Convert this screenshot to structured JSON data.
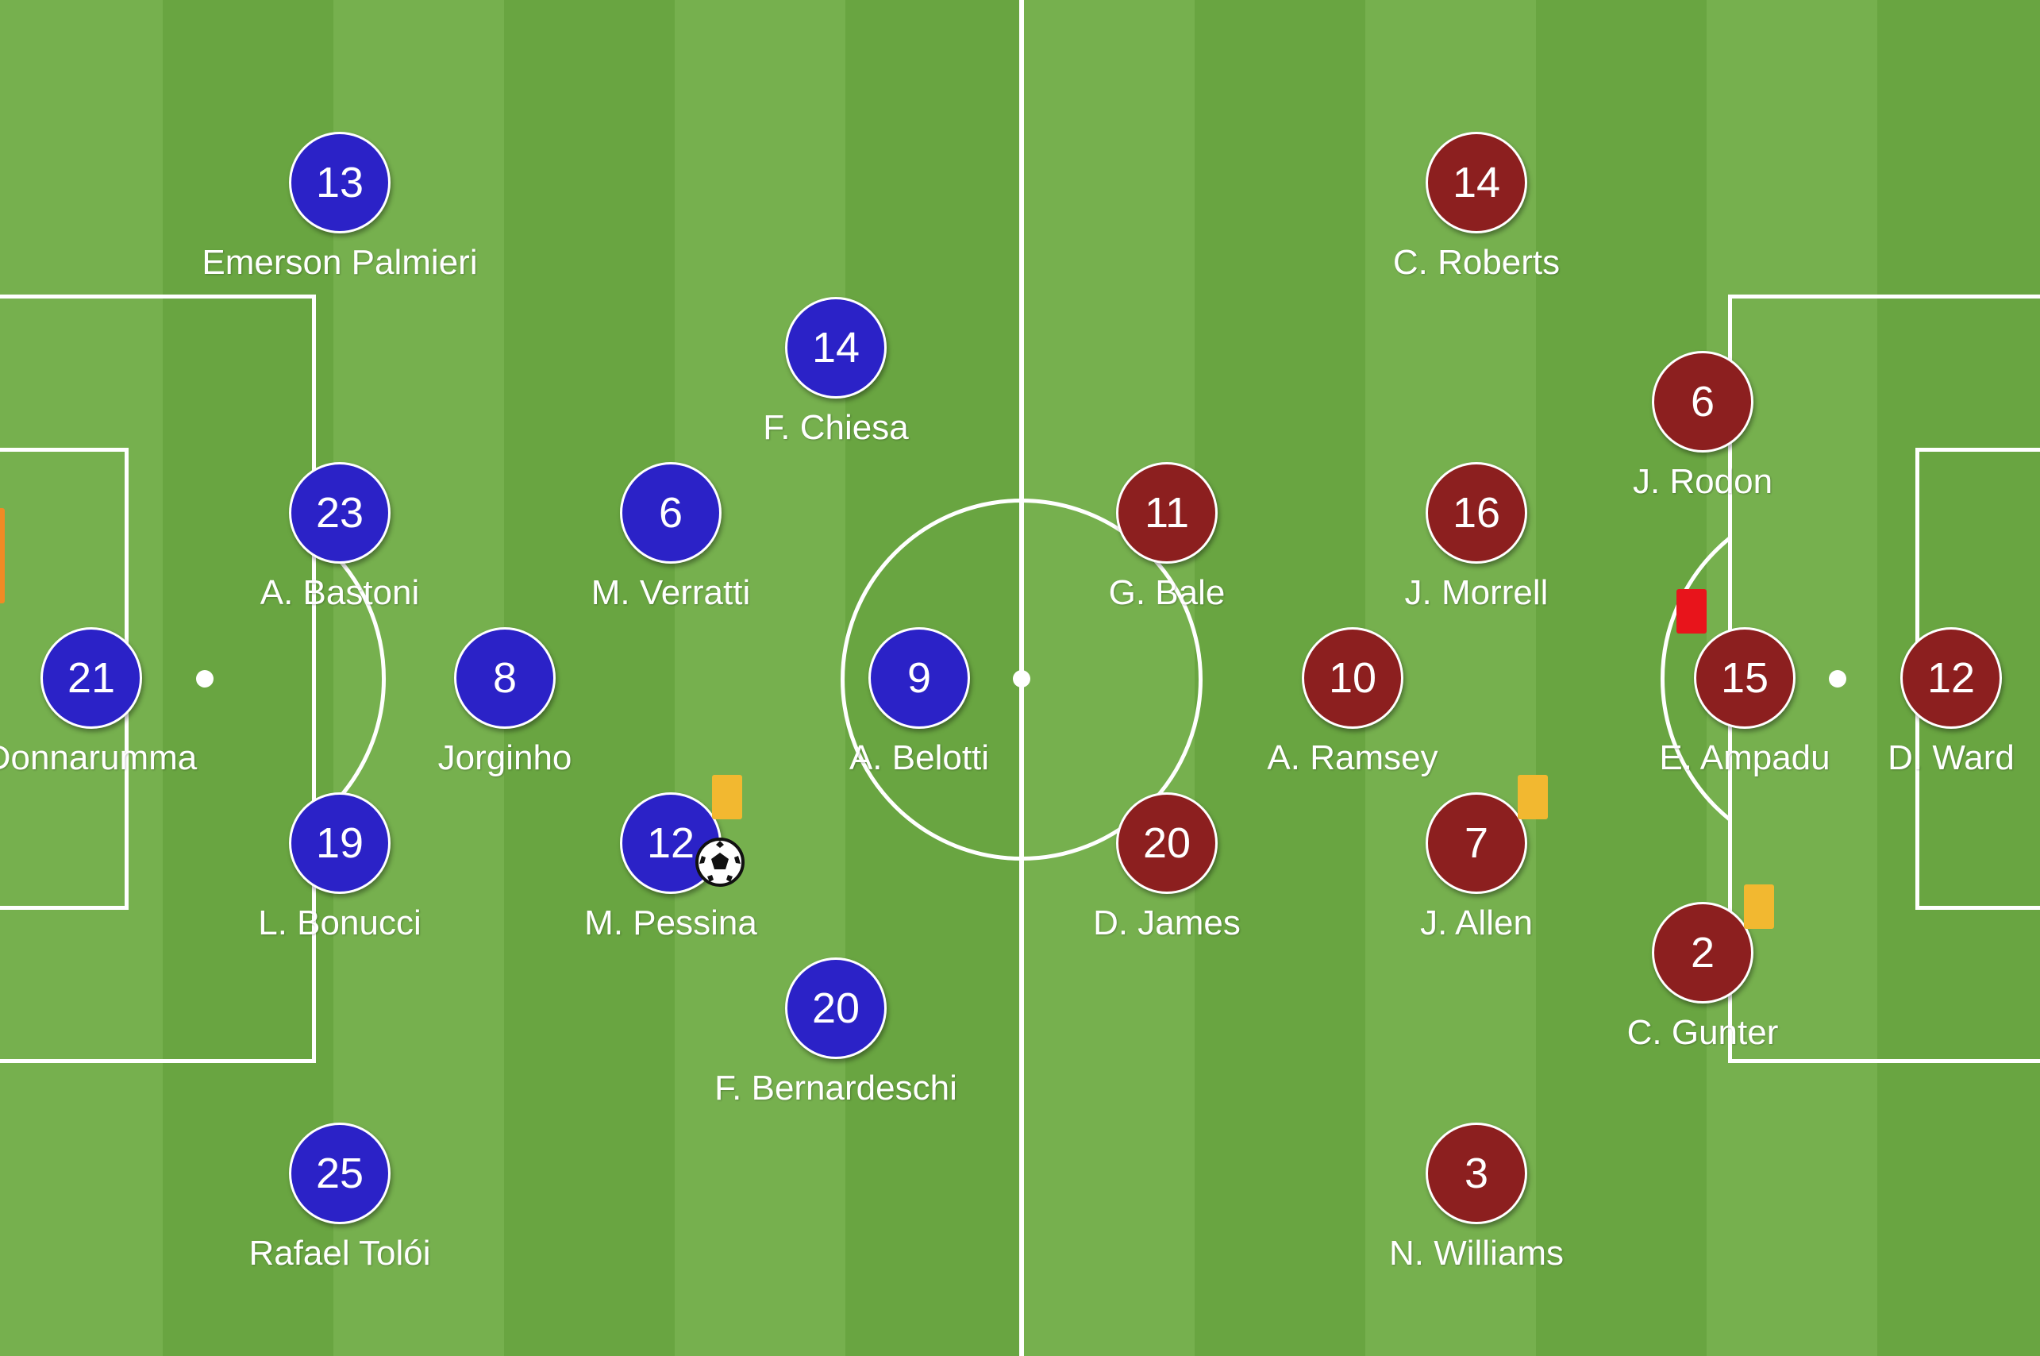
{
  "colors": {
    "pitch_light": "#76b04e",
    "pitch_dark": "#69a541",
    "line": "#ffffff",
    "home": "#2b22c7",
    "away": "#8c1f1f",
    "yellow_card": "#f2b830",
    "red_card": "#e8141b",
    "orange_card": "#f08a24"
  },
  "home_team": {
    "players": [
      {
        "number": "13",
        "name": "Emerson Palmieri"
      },
      {
        "number": "14",
        "name": "F. Chiesa"
      },
      {
        "number": "23",
        "name": "A. Bastoni"
      },
      {
        "number": "6",
        "name": "M. Verratti"
      },
      {
        "number": "21",
        "name": "Donnarumma"
      },
      {
        "number": "8",
        "name": "Jorginho"
      },
      {
        "number": "9",
        "name": "A. Belotti"
      },
      {
        "number": "19",
        "name": "L. Bonucci"
      },
      {
        "number": "12",
        "name": "M. Pessina",
        "card": "yellow",
        "ball_icon": "soccer-ball-icon"
      },
      {
        "number": "20",
        "name": "F. Bernardeschi"
      },
      {
        "number": "25",
        "name": "Rafael Tolói"
      }
    ]
  },
  "away_team": {
    "players": [
      {
        "number": "14",
        "name": "C. Roberts"
      },
      {
        "number": "6",
        "name": "J. Rodon"
      },
      {
        "number": "11",
        "name": "G. Bale"
      },
      {
        "number": "16",
        "name": "J. Morrell"
      },
      {
        "number": "10",
        "name": "A. Ramsey"
      },
      {
        "number": "15",
        "name": "E. Ampadu",
        "card": "red"
      },
      {
        "number": "12",
        "name": "D. Ward"
      },
      {
        "number": "20",
        "name": "D. James"
      },
      {
        "number": "7",
        "name": "J. Allen",
        "card": "yellow"
      },
      {
        "number": "2",
        "name": "C. Gunter",
        "card": "yellow"
      },
      {
        "number": "3",
        "name": "N. Williams"
      }
    ]
  }
}
